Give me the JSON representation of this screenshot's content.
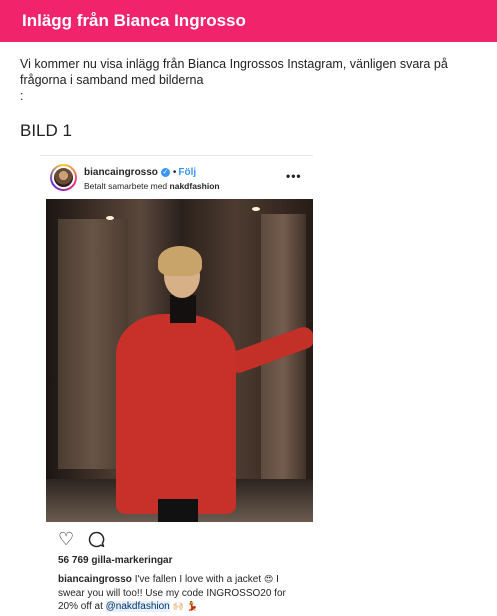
{
  "header": {
    "title": "Inlägg från Bianca Ingrosso",
    "color": "#f0236b"
  },
  "intro": {
    "text": "Vi kommer nu visa inlägg från Bianca Ingrossos Instagram, vänligen svara på frågorna i samband med bilderna",
    "colon": ":"
  },
  "section": {
    "title": "BILD 1"
  },
  "post": {
    "username": "biancaingrosso",
    "verified_glyph": "✓",
    "dot": "•",
    "follow_label": "Följ",
    "sponsored_prefix": "Betalt samarbete med",
    "sponsor": "nakdfashion",
    "more_glyph": "•••",
    "heart_glyph": "♡",
    "likes": "56 769 gilla-markeringar",
    "caption_user": "biancaingrosso",
    "caption_part1": "I've fallen I love with a jacket",
    "caption_emoji1": "😍",
    "caption_part2": "I swear you will too!! Use my code INGROSSO20 for 20% off at",
    "caption_mention": "@nakdfashion",
    "caption_emoji2": "🙌🏻 💃",
    "icons": {
      "like": "heart-icon",
      "comment": "comment-icon",
      "more": "more-icon",
      "verified": "verified-badge-icon"
    },
    "accent_color": "#3897f0"
  }
}
